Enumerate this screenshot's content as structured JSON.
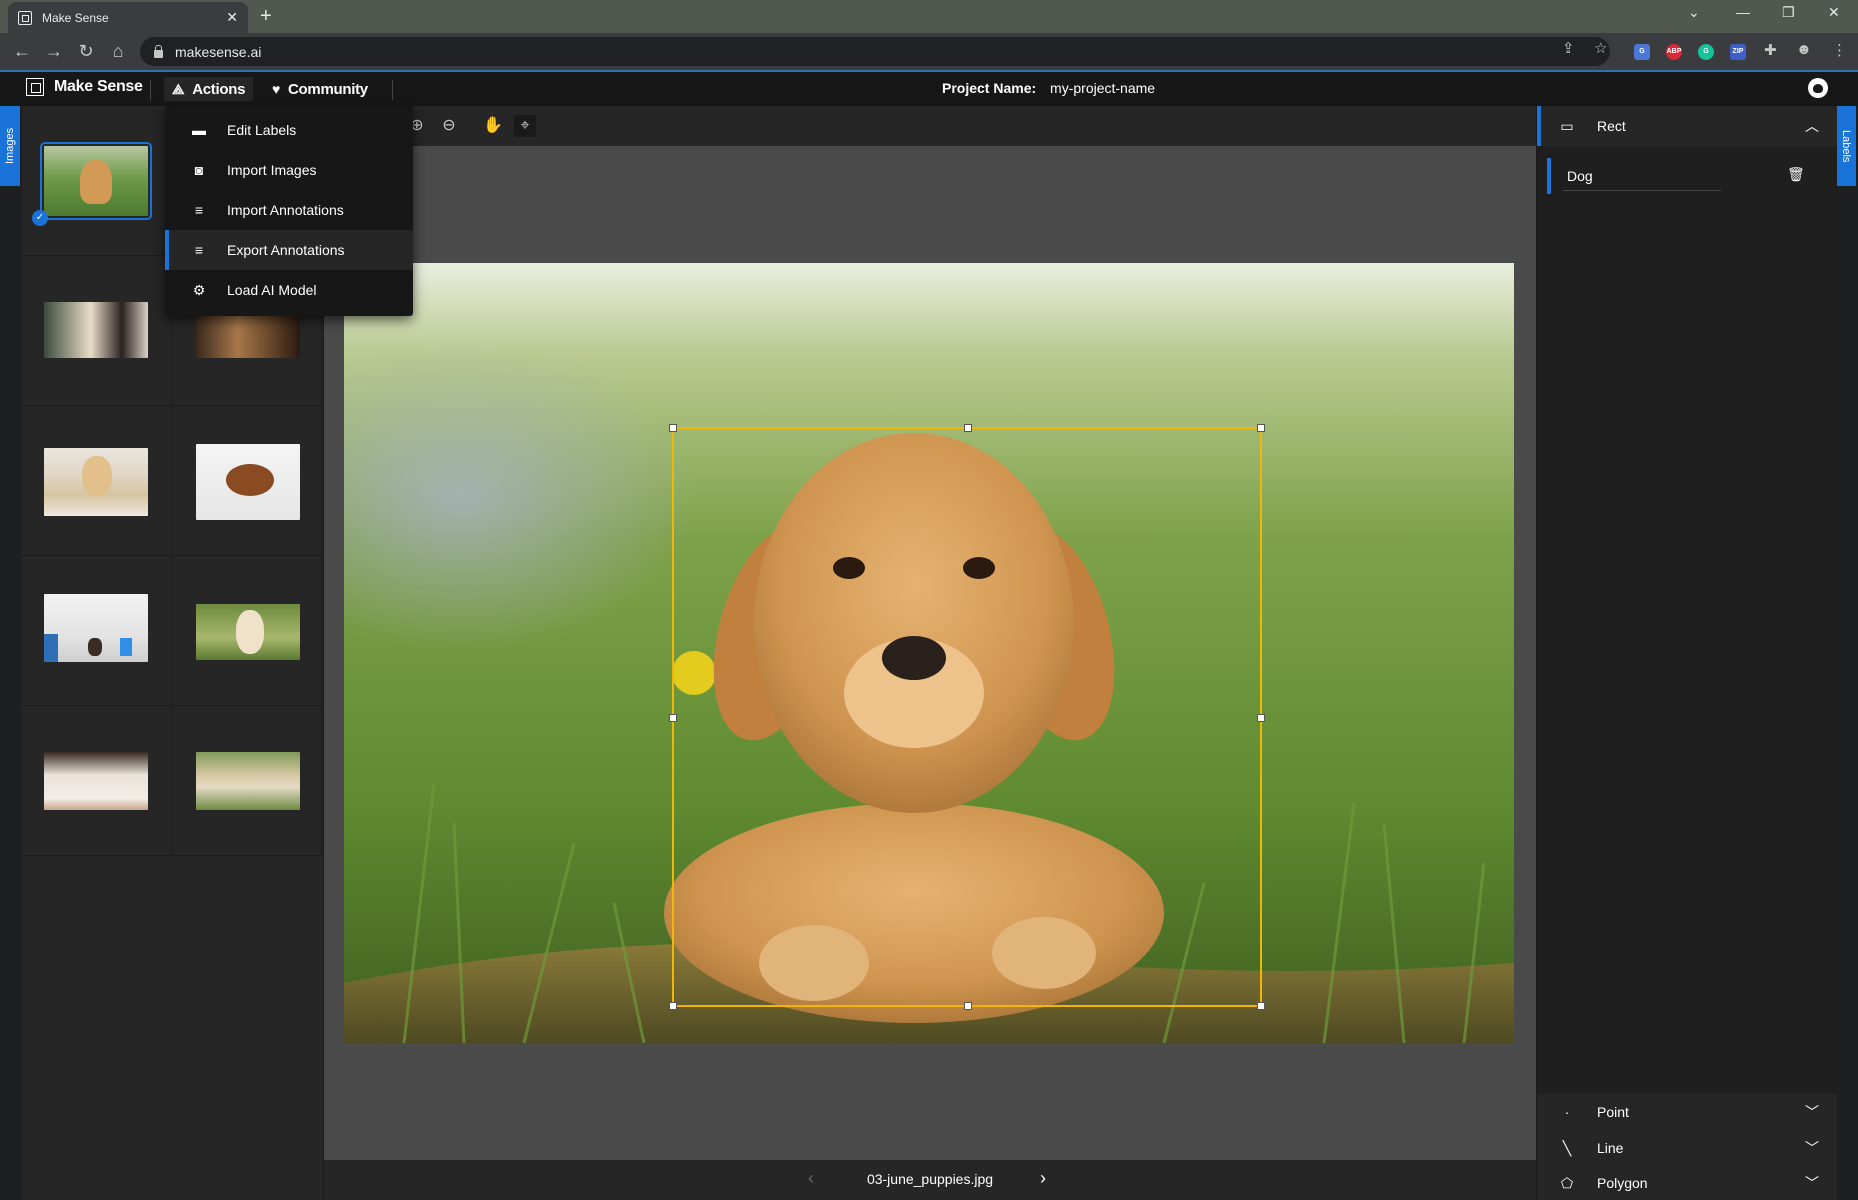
{
  "browser": {
    "tab_title": "Make Sense",
    "url": "makesense.ai"
  },
  "app": {
    "brand": "Make Sense",
    "nav": {
      "actions": "Actions",
      "community": "Community"
    },
    "project_label": "Project Name:",
    "project_name": "my-project-name"
  },
  "side_tabs": {
    "left": "Images",
    "right": "Labels"
  },
  "actions_menu": [
    {
      "label": "Edit Labels",
      "icon": "label-icon"
    },
    {
      "label": "Import Images",
      "icon": "camera-icon"
    },
    {
      "label": "Import Annotations",
      "icon": "import-icon"
    },
    {
      "label": "Export Annotations",
      "icon": "export-icon"
    },
    {
      "label": "Load AI Model",
      "icon": "ai-model-icon"
    }
  ],
  "editor": {
    "filename": "03-june_puppies.jpg"
  },
  "labels_panel": {
    "rect": {
      "title": "Rect",
      "labels": [
        {
          "name": "Dog"
        }
      ]
    },
    "point": {
      "title": "Point"
    },
    "line": {
      "title": "Line"
    },
    "polygon": {
      "title": "Polygon"
    }
  },
  "colors": {
    "accent": "#1a73d9",
    "bbox": "#f2b705",
    "panel": "#262626"
  }
}
